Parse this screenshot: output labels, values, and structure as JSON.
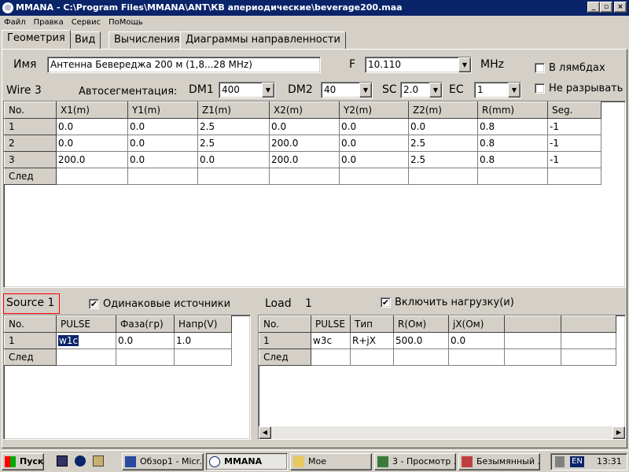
{
  "window": {
    "title": "MMANA - C:\\Program Files\\MMANA\\ANT\\КВ апериодические\\beverage200.maa",
    "min": "_",
    "max": "▫",
    "close": "×",
    "icon": "antenna-app-icon"
  },
  "menu": [
    "Файл",
    "Правка",
    "Сервис",
    "ПоМощь"
  ],
  "tabs": [
    "Геометрия",
    "Вид",
    "Вычисления",
    "Диаграммы направленности"
  ],
  "form": {
    "name_label": "Имя",
    "name_value": "Антенна Бевереджа 200 м (1,8...28 MHz)",
    "f_label": "F",
    "f_value": "10.110",
    "f_unit": "MHz",
    "lambda_label": "В лямбдах",
    "nobreak_label": "Не разрывать",
    "wire_label": "Wire 3",
    "autoseg_label": "Автосегментация:",
    "dm1_label": "DM1",
    "dm1_value": "400",
    "dm2_label": "DM2",
    "dm2_value": "40",
    "sc_label": "SC",
    "sc_value": "2.0",
    "ec_label": "EC",
    "ec_value": "1"
  },
  "wires": {
    "headers": [
      "No.",
      "X1(m)",
      "Y1(m)",
      "Z1(m)",
      "X2(m)",
      "Y2(m)",
      "Z2(m)",
      "R(mm)",
      "Seg."
    ],
    "rows": [
      [
        "1",
        "0.0",
        "0.0",
        "2.5",
        "0.0",
        "0.0",
        "0.0",
        "0.8",
        "-1"
      ],
      [
        "2",
        "0.0",
        "0.0",
        "2.5",
        "200.0",
        "0.0",
        "2.5",
        "0.8",
        "-1"
      ],
      [
        "3",
        "200.0",
        "0.0",
        "0.0",
        "200.0",
        "0.0",
        "2.5",
        "0.8",
        "-1"
      ]
    ],
    "next": "След"
  },
  "source": {
    "label": "Source 1",
    "same_label": "Одинаковые источники",
    "same_checked": "✔",
    "headers": [
      "No.",
      "PULSE",
      "Фаза(гр)",
      "Напр(V)"
    ],
    "row": [
      "1",
      "w1c",
      "0.0",
      "1.0"
    ],
    "next": "След"
  },
  "load": {
    "label": "Load",
    "count": "1",
    "enable_label": "Включить нагрузку(и)",
    "enable_checked": "✔",
    "headers": [
      "No.",
      "PULSE",
      "Тип",
      "R(Ом)",
      "jX(Ом)"
    ],
    "row": [
      "1",
      "w3c",
      "R+jX",
      "500.0",
      "0.0"
    ],
    "next": "След"
  },
  "taskbar": {
    "start": "Пуск",
    "items": [
      "Обзор1 - Micr...",
      "MMANA",
      "Мое",
      "3 - Просмотр ...",
      "Безымянный ..."
    ],
    "lang": "EN",
    "time": "13:31"
  },
  "colors": {
    "titlebar": "#0a246a",
    "source_highlight": "#ff0000",
    "face": "#d4d0c8"
  }
}
